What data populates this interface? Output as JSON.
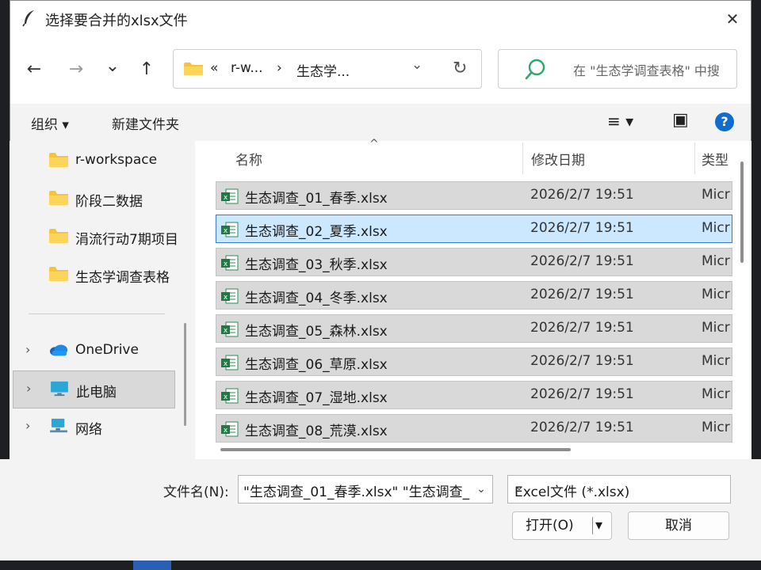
{
  "window": {
    "title": "选择要合并的xlsx文件",
    "close_glyph": "✕",
    "icon": "feather-icon"
  },
  "nav": {
    "back_glyph": "←",
    "forward_glyph": "→",
    "recent_glyph": "⌄",
    "up_glyph": "↑",
    "address": {
      "overflow": "«",
      "crumb_1": "r-w...",
      "separator": "›",
      "crumb_2": "生态学...",
      "dropdown_glyph": "⌄",
      "refresh_glyph": "↻"
    },
    "search_placeholder": "在 \"生态学调查表格\" 中搜"
  },
  "toolbar": {
    "organize": "组织 ▾",
    "new_folder": "新建文件夹",
    "view_glyph": "≡ ▾",
    "pane_glyph": "▣",
    "help_glyph": "?"
  },
  "sidebar": {
    "items": [
      {
        "label": "r-workspace",
        "icon": "folder-icon"
      },
      {
        "label": "阶段二数据",
        "icon": "folder-icon"
      },
      {
        "label": "涓流行动7期项目",
        "icon": "folder-icon"
      },
      {
        "label": "生态学调查表格",
        "icon": "folder-icon"
      },
      {
        "label": "OneDrive",
        "icon": "cloud-icon",
        "chevron": "›"
      },
      {
        "label": "此电脑",
        "icon": "computer-icon",
        "chevron": "›"
      },
      {
        "label": "网络",
        "icon": "network-icon",
        "chevron": "›"
      }
    ]
  },
  "columns": {
    "name": "名称",
    "modified": "修改日期",
    "type": "类型",
    "sort_glyph": "^"
  },
  "files": [
    {
      "name": "生态调查_01_春季.xlsx",
      "modified": "2026/2/7 19:51",
      "type": "Micr"
    },
    {
      "name": "生态调查_02_夏季.xlsx",
      "modified": "2026/2/7 19:51",
      "type": "Micr"
    },
    {
      "name": "生态调查_03_秋季.xlsx",
      "modified": "2026/2/7 19:51",
      "type": "Micr"
    },
    {
      "name": "生态调查_04_冬季.xlsx",
      "modified": "2026/2/7 19:51",
      "type": "Micr"
    },
    {
      "name": "生态调查_05_森林.xlsx",
      "modified": "2026/2/7 19:51",
      "type": "Micr"
    },
    {
      "name": "生态调查_06_草原.xlsx",
      "modified": "2026/2/7 19:51",
      "type": "Micr"
    },
    {
      "name": "生态调查_07_湿地.xlsx",
      "modified": "2026/2/7 19:51",
      "type": "Micr"
    },
    {
      "name": "生态调查_08_荒漠.xlsx",
      "modified": "2026/2/7 19:51",
      "type": "Micr"
    }
  ],
  "footer": {
    "filename_label": "文件名(N):",
    "filename_value": "\"生态调查_01_春季.xlsx\" \"生态调查_",
    "filter_value": "Excel文件 (*.xlsx)",
    "dropdown_glyph": "⌄",
    "open_label": "打开(O)",
    "open_split_glyph": "▾",
    "cancel_label": "取消"
  },
  "colors": {
    "accent": "#0067c0",
    "selected_row": "#d9d9d9",
    "focused_row": "#cce8ff",
    "excel_green": "#1f7a44",
    "folder_yellow": "#f6c33c"
  }
}
